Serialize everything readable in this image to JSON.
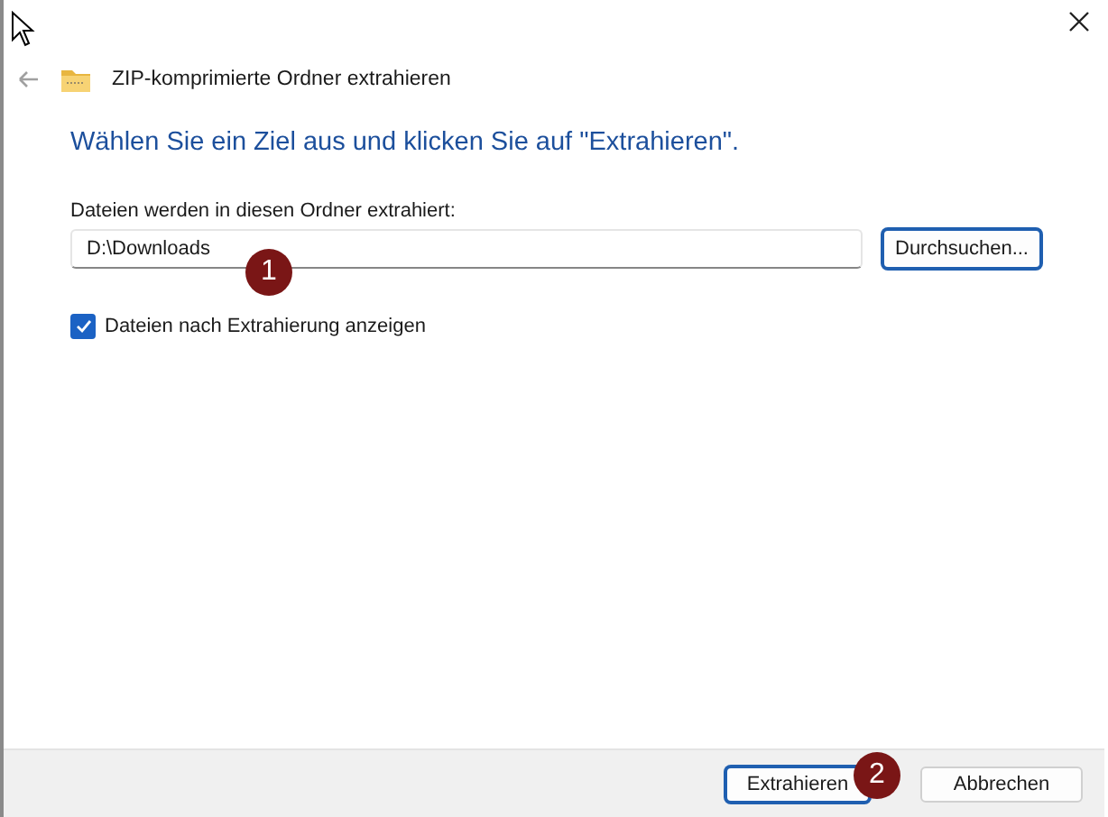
{
  "window": {
    "title": "ZIP-komprimierte Ordner extrahieren"
  },
  "heading": "Wählen Sie ein Ziel aus und klicken Sie auf \"Extrahieren\".",
  "folder_label": "Dateien werden in diesen Ordner extrahiert:",
  "folder_field": {
    "value": "D:\\Downloads"
  },
  "browse_button": "Durchsuchen...",
  "show_files": {
    "label": "Dateien nach Extrahierung anzeigen",
    "checked": true
  },
  "buttons": [
    {
      "label": "Extrahieren",
      "default": true
    },
    {
      "label": "Abbrechen",
      "default": false
    }
  ],
  "markers": [
    "1",
    "2"
  ]
}
